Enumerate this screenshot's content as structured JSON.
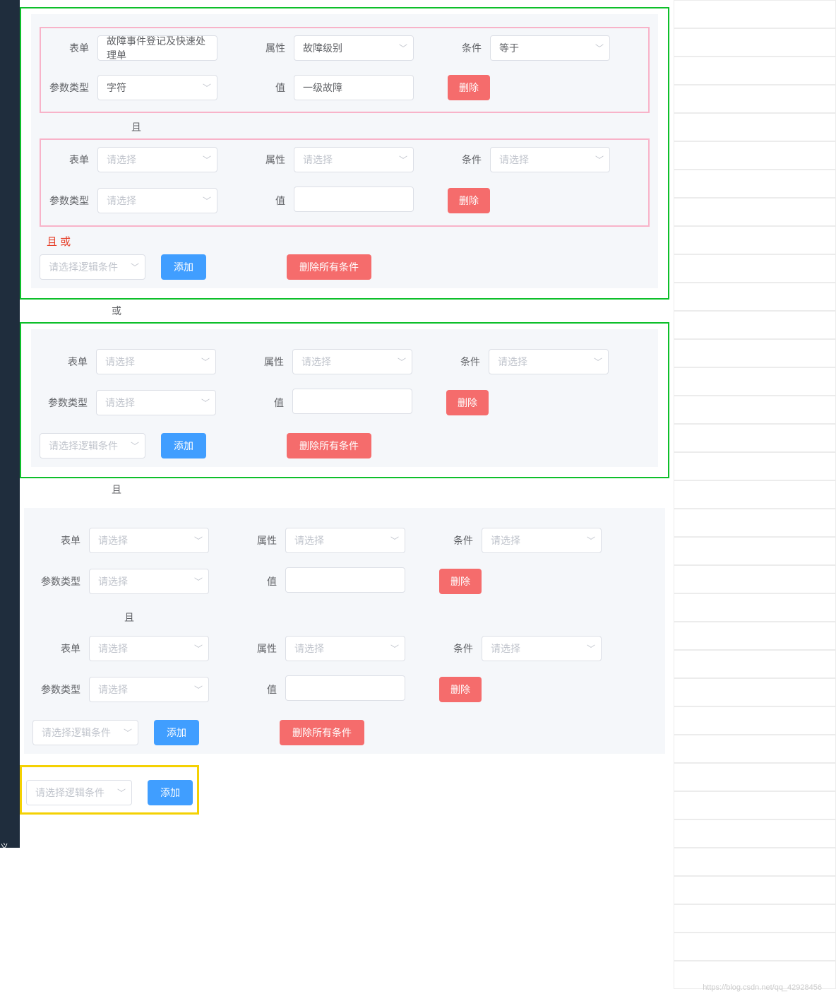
{
  "labels": {
    "form": "表单",
    "attr": "属性",
    "cond": "条件",
    "ptype": "参数类型",
    "value": "值"
  },
  "placeholder": {
    "select": "请选择",
    "logic": "请选择逻辑条件"
  },
  "buttons": {
    "add": "添加",
    "delete": "删除",
    "deleteAll": "删除所有条件"
  },
  "connectors": {
    "and": "且",
    "or": "或",
    "and_or_note": "且  或"
  },
  "groups": [
    {
      "outline": "green",
      "subgroups": [
        {
          "outline": "pink",
          "rows": [
            {
              "form": "故障事件登记及快速处理单",
              "attr": "故障级别",
              "cond": "等于",
              "ptype": "字符",
              "value": "一级故障"
            }
          ]
        },
        {
          "connector": "and"
        },
        {
          "outline": "pink",
          "rows": [
            {
              "form": "",
              "attr": "",
              "cond": "",
              "ptype": "",
              "value": ""
            }
          ]
        },
        {
          "note": "and_or_note"
        },
        {
          "footer": true,
          "hasDeleteAll": true
        }
      ]
    },
    {
      "connector": "or"
    },
    {
      "outline": "green",
      "subgroups": [
        {
          "outline": "none",
          "rows": [
            {
              "form": "",
              "attr": "",
              "cond": "",
              "ptype": "",
              "value": ""
            }
          ]
        },
        {
          "footer": true,
          "hasDeleteAll": true
        }
      ]
    },
    {
      "connector": "and"
    },
    {
      "outline": "none",
      "subgroups": [
        {
          "outline": "none",
          "rows": [
            {
              "form": "",
              "attr": "",
              "cond": "",
              "ptype": "",
              "value": ""
            }
          ]
        },
        {
          "connector": "and"
        },
        {
          "outline": "none",
          "rows": [
            {
              "form": "",
              "attr": "",
              "cond": "",
              "ptype": "",
              "value": ""
            }
          ]
        },
        {
          "footer": true,
          "hasDeleteAll": true
        }
      ]
    },
    {
      "yellowFooter": true
    }
  ],
  "footer_text": "义",
  "watermark": "https://blog.csdn.net/qq_42928456"
}
